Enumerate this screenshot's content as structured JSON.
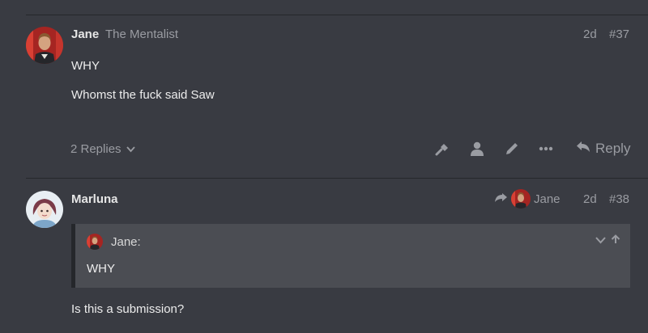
{
  "posts": [
    {
      "username": "Jane",
      "user_title": "The Mentalist",
      "age": "2d",
      "number": "#37",
      "lines": [
        "WHY",
        "Whomst the fuck said Saw"
      ],
      "replies_label": "2 Replies",
      "reply_label": "Reply"
    },
    {
      "username": "Marluna",
      "reply_to_user": "Jane",
      "age": "2d",
      "number": "#38",
      "quote": {
        "author": "Jane:",
        "text": "WHY"
      },
      "lines": [
        "Is this a submission?"
      ]
    }
  ],
  "icons": {
    "wrench": "wrench-icon",
    "user": "user-icon",
    "edit": "pencil-icon",
    "more": "ellipsis-icon",
    "reply": "reply-arrow-icon",
    "chevron": "chevron-down-icon"
  },
  "colors": {
    "background": "#393b42",
    "muted_text": "#9a9ca2",
    "quote_bg": "#4b4d53"
  }
}
